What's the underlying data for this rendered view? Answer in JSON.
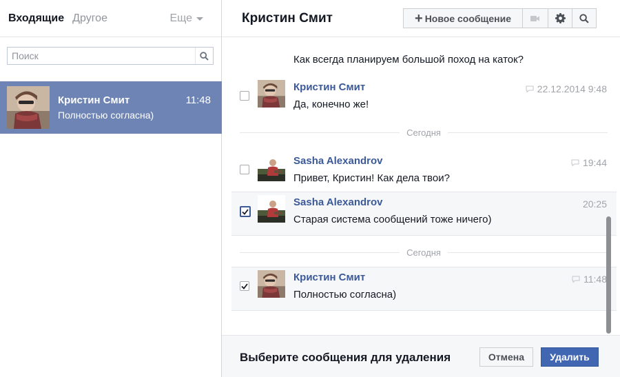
{
  "sidebar": {
    "tabs": {
      "inbox": "Входящие",
      "other": "Другое",
      "more": "Еще"
    },
    "search": {
      "placeholder": "Поиск"
    },
    "threads": [
      {
        "name": "Кристин Смит",
        "time": "11:48",
        "preview": "Полностью согласна)",
        "selected": true
      }
    ]
  },
  "conversation": {
    "title": "Кристин Смит",
    "toolbar": {
      "new_message_label": "Новое сообщение"
    },
    "messages": [
      {
        "text": "Как всегда планируем большой поход на каток?"
      },
      {
        "author": "Кристин Смит",
        "text": "Да, конечно же!",
        "time": "22.12.2014 9:48",
        "checked": false
      },
      {
        "divider": "Сегодня"
      },
      {
        "author": "Sasha Alexandrov",
        "text": "Привет, Кристин! Как дела твои?",
        "time": "19:44",
        "checked": false
      },
      {
        "author": "Sasha Alexandrov",
        "text": "Старая система сообщений тоже ничего)",
        "time": "20:25",
        "checked": true
      },
      {
        "divider": "Сегодня"
      },
      {
        "author": "Кристин Смит",
        "text": "Полностью согласна)",
        "time": "11:48",
        "checked": true
      }
    ]
  },
  "footer": {
    "prompt": "Выберите сообщения для удаления",
    "cancel_label": "Отмена",
    "delete_label": "Удалить"
  },
  "colors": {
    "selected_thread_bg": "#6d84b4",
    "author_link": "#3b5998",
    "primary_button": "#4267b2"
  }
}
